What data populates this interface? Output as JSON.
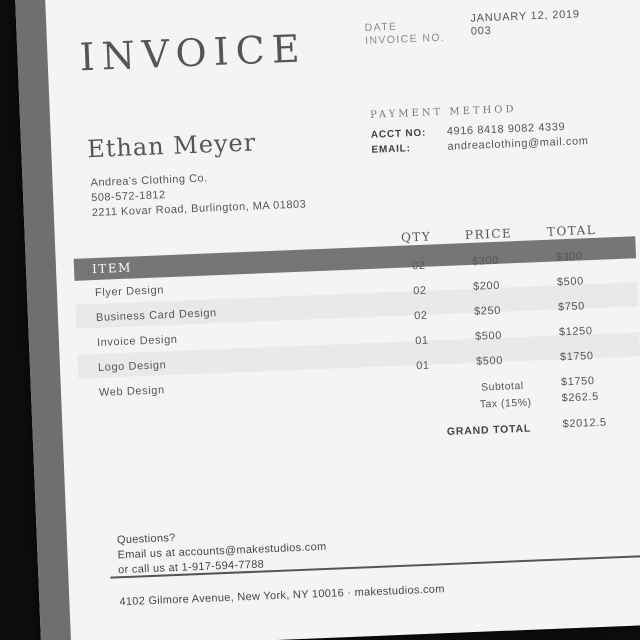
{
  "invoice": {
    "title": "INVOICE",
    "meta": {
      "date_label": "DATE",
      "date_value": "JANUARY 12, 2019",
      "number_label": "INVOICE NO.",
      "number_value": "003"
    },
    "bill_to": {
      "name": "Ethan Meyer",
      "company": "Andrea's  Clothing Co.",
      "phone": "508-572-1812",
      "address": "2211 Kovar Road, Burlington, MA 01803"
    },
    "payment": {
      "title": "PAYMENT METHOD",
      "acct_label": "ACCT NO:",
      "acct_value": "4916 8418 9082 4339",
      "email_label": "EMAIL:",
      "email_value": "andreaclothing@mail.com"
    },
    "table": {
      "headers": {
        "item": "ITEM",
        "qty": "QTY",
        "price": "PRICE",
        "total": "TOTAL"
      },
      "rows": [
        {
          "item": "Flyer Design",
          "qty": "02",
          "price": "$300",
          "total": "$300"
        },
        {
          "item": "Business Card Design",
          "qty": "02",
          "price": "$200",
          "total": "$500"
        },
        {
          "item": "Invoice Design",
          "qty": "02",
          "price": "$250",
          "total": "$750"
        },
        {
          "item": "Logo Design",
          "qty": "01",
          "price": "$500",
          "total": "$1250"
        },
        {
          "item": "Web Design",
          "qty": "01",
          "price": "$500",
          "total": "$1750"
        }
      ]
    },
    "totals": {
      "subtotal_label": "Subtotal",
      "subtotal_value": "$1750",
      "tax_label": "Tax (15%)",
      "tax_value": "$262.5",
      "grand_label": "GRAND TOTAL",
      "grand_value": "$2012.5"
    },
    "footer": {
      "questions": "Questions?",
      "email_line": "Email us at accounts@makestudios.com",
      "phone_line": "or call us at 1-917-594-7788",
      "address_line": "4102 Gilmore Avenue, New York, NY 10016 · makestudios.com"
    },
    "colors": {
      "side_bar": "#6f6f6f",
      "header_band": "#767676",
      "paper": "#f4f4f4",
      "background": "#0c0c0c"
    }
  }
}
